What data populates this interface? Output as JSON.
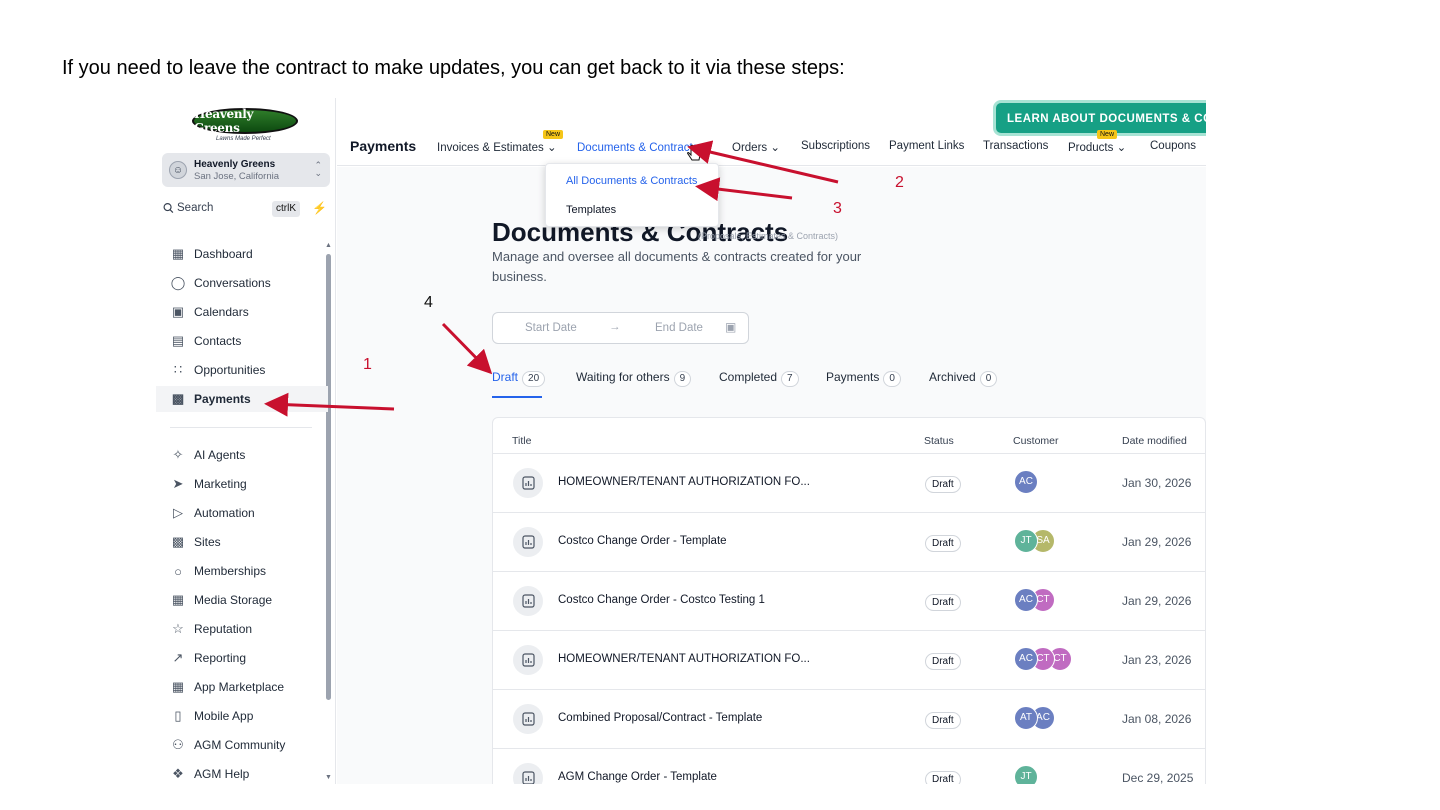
{
  "instruction": "If you need to leave the contract to make updates, you can get back to it via these steps:",
  "logo": {
    "name": "Heavenly Greens",
    "tagline": "Lawns Made Perfect"
  },
  "account": {
    "name": "Heavenly Greens",
    "location": "San Jose, California"
  },
  "search": {
    "label": "Search",
    "shortcut": "ctrlK"
  },
  "sidebar": {
    "items": [
      {
        "label": "Dashboard",
        "icon": "grid-icon"
      },
      {
        "label": "Conversations",
        "icon": "chat-bubble-icon"
      },
      {
        "label": "Calendars",
        "icon": "calendar-icon"
      },
      {
        "label": "Contacts",
        "icon": "contact-card-icon"
      },
      {
        "label": "Opportunities",
        "icon": "pipeline-icon"
      },
      {
        "label": "Payments",
        "icon": "receipt-icon",
        "active": true
      },
      {
        "label": "AI Agents",
        "icon": "sparkle-icon"
      },
      {
        "label": "Marketing",
        "icon": "send-icon"
      },
      {
        "label": "Automation",
        "icon": "play-circle-icon"
      },
      {
        "label": "Sites",
        "icon": "globe-icon"
      },
      {
        "label": "Memberships",
        "icon": "award-icon"
      },
      {
        "label": "Media Storage",
        "icon": "image-icon"
      },
      {
        "label": "Reputation",
        "icon": "star-icon"
      },
      {
        "label": "Reporting",
        "icon": "trend-icon"
      },
      {
        "label": "App Marketplace",
        "icon": "apps-icon"
      },
      {
        "label": "Mobile App",
        "icon": "phone-icon"
      },
      {
        "label": "AGM Community",
        "icon": "people-icon"
      },
      {
        "label": "AGM Help",
        "icon": "info-icon"
      }
    ]
  },
  "topbar": {
    "learn_button": "LEARN ABOUT DOCUMENTS & CO",
    "section_title": "Payments",
    "nav": [
      {
        "label": "Invoices & Estimates",
        "dropdown": true
      },
      {
        "label": "Documents & Contracts",
        "dropdown": true,
        "active": true,
        "badge": "New"
      },
      {
        "label": "Orders",
        "dropdown": true
      },
      {
        "label": "Subscriptions"
      },
      {
        "label": "Payment Links"
      },
      {
        "label": "Transactions"
      },
      {
        "label": "Products",
        "dropdown": true,
        "badge": "New"
      },
      {
        "label": "Coupons"
      }
    ]
  },
  "dropdown": {
    "items": [
      {
        "label": "All Documents & Contracts",
        "active": true
      },
      {
        "label": "Templates"
      }
    ]
  },
  "page": {
    "title": "Documents & Contracts",
    "subtitle": "(Proposals, Estimates & Contracts)",
    "description": "Manage and oversee all documents & contracts created for your business.",
    "start_date_placeholder": "Start Date",
    "end_date_placeholder": "End Date",
    "arrow": "→"
  },
  "tabs": [
    {
      "label": "Draft",
      "count": "20",
      "active": true
    },
    {
      "label": "Waiting for others",
      "count": "9"
    },
    {
      "label": "Completed",
      "count": "7"
    },
    {
      "label": "Payments",
      "count": "0"
    },
    {
      "label": "Archived",
      "count": "0"
    }
  ],
  "table": {
    "columns": [
      "Title",
      "Status",
      "Customer",
      "Date modified"
    ],
    "rows": [
      {
        "title": "HOMEOWNER/TENANT AUTHORIZATION FO...",
        "status": "Draft",
        "customers": [
          {
            "initials": "AC",
            "color": "#6b7fc1"
          }
        ],
        "date": "Jan 30, 2026"
      },
      {
        "title": "Costco Change Order - Template",
        "status": "Draft",
        "customers": [
          {
            "initials": "JT",
            "color": "#5fb39a"
          },
          {
            "initials": "SA",
            "color": "#b5b86a"
          }
        ],
        "date": "Jan 29, 2026"
      },
      {
        "title": "Costco Change Order - Costco Testing 1",
        "status": "Draft",
        "customers": [
          {
            "initials": "AC",
            "color": "#6b7fc1"
          },
          {
            "initials": "CT",
            "color": "#c06bc1"
          }
        ],
        "date": "Jan 29, 2026"
      },
      {
        "title": "HOMEOWNER/TENANT AUTHORIZATION FO...",
        "status": "Draft",
        "customers": [
          {
            "initials": "AC",
            "color": "#6b7fc1"
          },
          {
            "initials": "CT",
            "color": "#c06bc1"
          },
          {
            "initials": "CT",
            "color": "#c06bc1"
          }
        ],
        "date": "Jan 23, 2026"
      },
      {
        "title": "Combined Proposal/Contract - Template",
        "status": "Draft",
        "customers": [
          {
            "initials": "AT",
            "color": "#6b7fc1"
          },
          {
            "initials": "AC",
            "color": "#6b7fc1"
          }
        ],
        "date": "Jan 08, 2026"
      },
      {
        "title": "AGM Change Order - Template",
        "status": "Draft",
        "customers": [
          {
            "initials": "JT",
            "color": "#5fb39a"
          }
        ],
        "date": "Dec 29, 2025"
      }
    ]
  },
  "annotations": [
    {
      "number": "1",
      "target": "Payments sidebar item"
    },
    {
      "number": "2",
      "target": "Documents & Contracts menu"
    },
    {
      "number": "3",
      "target": "All Documents & Contracts"
    },
    {
      "number": "4",
      "target": "Draft tab"
    }
  ],
  "colors": {
    "accent": "#2563eb",
    "annotation": "#c8102e",
    "learn_button": "#16a085"
  }
}
